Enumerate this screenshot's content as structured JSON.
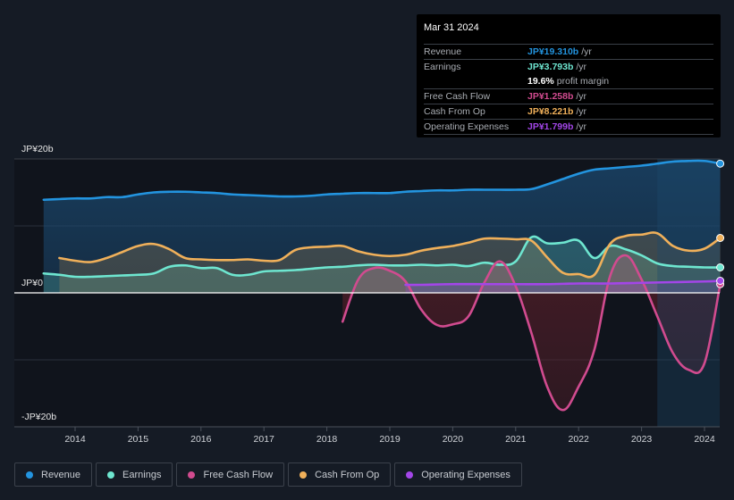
{
  "tooltip": {
    "date": "Mar 31 2024",
    "rows": [
      {
        "label": "Revenue",
        "value": "JP¥19.310b",
        "unit": "/yr",
        "color": "#2394df"
      },
      {
        "label": "Earnings",
        "value": "JP¥3.793b",
        "unit": "/yr",
        "color": "#6ee6d0"
      },
      {
        "label": "",
        "value": "19.6%",
        "unit": "profit margin",
        "color": "#ffffff"
      },
      {
        "label": "Free Cash Flow",
        "value": "JP¥1.258b",
        "unit": "/yr",
        "color": "#d14b8f"
      },
      {
        "label": "Cash From Op",
        "value": "JP¥8.221b",
        "unit": "/yr",
        "color": "#f0b05a"
      },
      {
        "label": "Operating Expenses",
        "value": "JP¥1.799b",
        "unit": "/yr",
        "color": "#a346e8"
      }
    ]
  },
  "legend": [
    {
      "label": "Revenue",
      "color": "#2394df"
    },
    {
      "label": "Earnings",
      "color": "#6ee6d0"
    },
    {
      "label": "Free Cash Flow",
      "color": "#d14b8f"
    },
    {
      "label": "Cash From Op",
      "color": "#f0b05a"
    },
    {
      "label": "Operating Expenses",
      "color": "#a346e8"
    }
  ],
  "chart_data": {
    "type": "area",
    "title": "",
    "xlabel": "",
    "ylabel": "",
    "unit": "JP¥ billions",
    "ylim": [
      -20,
      20
    ],
    "y_ticks": [
      {
        "value": 20,
        "label": "JP¥20b"
      },
      {
        "value": 0,
        "label": "JP¥0"
      },
      {
        "value": -20,
        "label": "-JP¥20b"
      }
    ],
    "x_ticks": [
      "2014",
      "2015",
      "2016",
      "2017",
      "2018",
      "2019",
      "2020",
      "2021",
      "2022",
      "2023",
      "2024"
    ],
    "xlim": [
      2013.5,
      2024.25
    ],
    "forecast_shade_start": 2023.25,
    "grid": true,
    "legend_position": "bottom",
    "series": [
      {
        "name": "Revenue",
        "color": "#2394df",
        "x": [
          2013.5,
          2013.75,
          2014.0,
          2014.25,
          2014.5,
          2014.75,
          2015.0,
          2015.25,
          2015.5,
          2015.75,
          2016.0,
          2016.25,
          2016.5,
          2016.75,
          2017.0,
          2017.25,
          2017.5,
          2017.75,
          2018.0,
          2018.25,
          2018.5,
          2018.75,
          2019.0,
          2019.25,
          2019.5,
          2019.75,
          2020.0,
          2020.25,
          2020.5,
          2020.75,
          2021.0,
          2021.25,
          2021.5,
          2021.75,
          2022.0,
          2022.25,
          2022.5,
          2022.75,
          2023.0,
          2023.25,
          2023.5,
          2023.75,
          2024.0,
          2024.25
        ],
        "values": [
          13.9,
          14.0,
          14.1,
          14.1,
          14.3,
          14.3,
          14.7,
          15.0,
          15.1,
          15.1,
          15.0,
          14.9,
          14.7,
          14.6,
          14.5,
          14.4,
          14.4,
          14.5,
          14.7,
          14.8,
          14.9,
          14.9,
          14.9,
          15.1,
          15.2,
          15.3,
          15.3,
          15.4,
          15.4,
          15.4,
          15.4,
          15.5,
          16.2,
          17.0,
          17.8,
          18.4,
          18.6,
          18.8,
          19.0,
          19.3,
          19.6,
          19.7,
          19.7,
          19.3
        ]
      },
      {
        "name": "Earnings",
        "color": "#6ee6d0",
        "x": [
          2013.5,
          2013.75,
          2014.0,
          2014.25,
          2014.5,
          2014.75,
          2015.0,
          2015.25,
          2015.5,
          2015.75,
          2016.0,
          2016.25,
          2016.5,
          2016.75,
          2017.0,
          2017.25,
          2017.5,
          2017.75,
          2018.0,
          2018.25,
          2018.5,
          2018.75,
          2019.0,
          2019.25,
          2019.5,
          2019.75,
          2020.0,
          2020.25,
          2020.5,
          2020.75,
          2021.0,
          2021.25,
          2021.5,
          2021.75,
          2022.0,
          2022.25,
          2022.5,
          2022.75,
          2023.0,
          2023.25,
          2023.5,
          2023.75,
          2024.0,
          2024.25
        ],
        "values": [
          2.9,
          2.7,
          2.4,
          2.4,
          2.5,
          2.6,
          2.7,
          2.9,
          3.9,
          4.1,
          3.7,
          3.7,
          2.7,
          2.7,
          3.2,
          3.3,
          3.4,
          3.6,
          3.8,
          3.9,
          4.1,
          4.2,
          4.1,
          4.1,
          4.2,
          4.1,
          4.2,
          4.0,
          4.5,
          4.2,
          4.7,
          8.3,
          7.4,
          7.5,
          7.8,
          5.2,
          7.0,
          6.5,
          5.6,
          4.4,
          4.0,
          3.9,
          3.8,
          3.8
        ]
      },
      {
        "name": "Free Cash Flow",
        "color": "#d14b8f",
        "x": [
          2018.25,
          2018.5,
          2018.75,
          2019.0,
          2019.25,
          2019.5,
          2019.75,
          2020.0,
          2020.25,
          2020.5,
          2020.75,
          2021.0,
          2021.25,
          2021.5,
          2021.75,
          2022.0,
          2022.25,
          2022.5,
          2022.75,
          2023.0,
          2023.25,
          2023.5,
          2023.75,
          2024.0,
          2024.25
        ],
        "values": [
          -4.3,
          2.0,
          3.7,
          3.3,
          1.7,
          -2.5,
          -4.8,
          -4.7,
          -3.5,
          1.5,
          4.7,
          1.0,
          -6.0,
          -14.0,
          -17.5,
          -14.0,
          -8.5,
          2.5,
          5.6,
          2.0,
          -3.5,
          -9.0,
          -11.5,
          -10.5,
          1.3
        ]
      },
      {
        "name": "Cash From Op",
        "color": "#f0b05a",
        "x": [
          2013.75,
          2014.0,
          2014.25,
          2014.5,
          2014.75,
          2015.0,
          2015.25,
          2015.5,
          2015.75,
          2016.0,
          2016.25,
          2016.5,
          2016.75,
          2017.0,
          2017.25,
          2017.5,
          2017.75,
          2018.0,
          2018.25,
          2018.5,
          2018.75,
          2019.0,
          2019.25,
          2019.5,
          2019.75,
          2020.0,
          2020.25,
          2020.5,
          2020.75,
          2021.0,
          2021.25,
          2021.5,
          2021.75,
          2022.0,
          2022.25,
          2022.5,
          2022.75,
          2023.0,
          2023.25,
          2023.5,
          2023.75,
          2024.0,
          2024.25
        ],
        "values": [
          5.2,
          4.8,
          4.6,
          5.2,
          6.1,
          7.0,
          7.3,
          6.5,
          5.2,
          5.0,
          4.9,
          4.9,
          5.0,
          4.8,
          4.9,
          6.4,
          6.8,
          6.9,
          7.0,
          6.2,
          5.7,
          5.5,
          5.7,
          6.3,
          6.7,
          7.0,
          7.5,
          8.1,
          8.1,
          8.0,
          7.8,
          5.3,
          3.0,
          2.8,
          2.7,
          7.3,
          8.5,
          8.7,
          8.9,
          7.0,
          6.3,
          6.6,
          8.2
        ]
      },
      {
        "name": "Operating Expenses",
        "color": "#a346e8",
        "x": [
          2019.25,
          2019.5,
          2020.0,
          2020.5,
          2021.0,
          2021.5,
          2022.0,
          2022.5,
          2023.0,
          2023.5,
          2024.0,
          2024.25
        ],
        "values": [
          1.2,
          1.2,
          1.3,
          1.3,
          1.3,
          1.3,
          1.4,
          1.4,
          1.5,
          1.6,
          1.7,
          1.8
        ]
      }
    ]
  }
}
